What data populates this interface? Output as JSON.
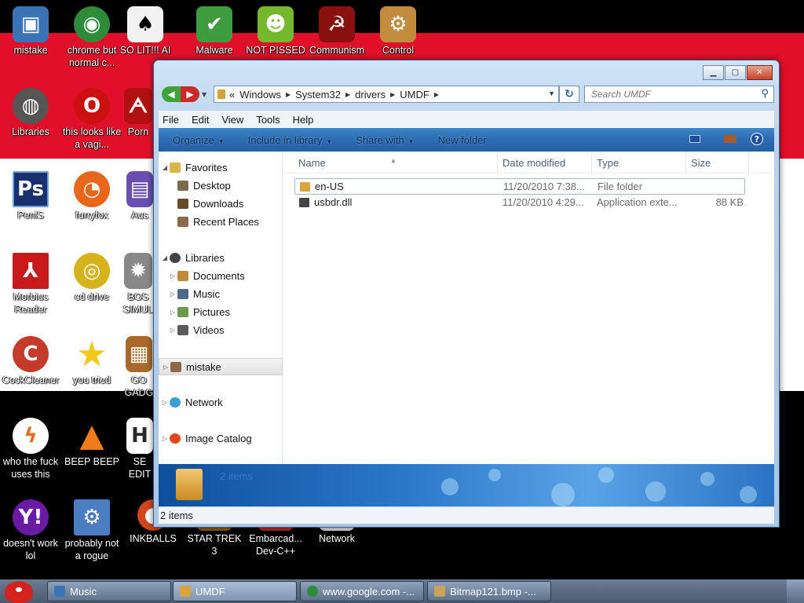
{
  "desktop": {
    "icons": [
      {
        "label": "mistake",
        "icon": "computer-icon",
        "color": "#3a73b6"
      },
      {
        "label": "chrome but normal c...",
        "icon": "chrome-icon",
        "color": "#2e8b3a"
      },
      {
        "label": "SO LIT!!! AI",
        "icon": "cards-icon",
        "color": "#f2f2f2"
      },
      {
        "label": "Malware",
        "icon": "shield-icon",
        "color": "#3e9b3e"
      },
      {
        "label": "NOT PISSED",
        "icon": "pig-icon",
        "color": "#74b82b"
      },
      {
        "label": "Communism",
        "icon": "banner-icon",
        "color": "#8a1010"
      },
      {
        "label": "Control",
        "icon": "control-panel-icon",
        "color": "#c38b3c"
      },
      {
        "label": "Libraries",
        "icon": "library-icon",
        "color": "#555555"
      },
      {
        "label": "this looks like a vagi...",
        "icon": "opera-icon",
        "color": "#cc1010"
      },
      {
        "label": "Porn",
        "icon": "acrobat-icon",
        "color": "#b01010"
      },
      {
        "label": "PeniS",
        "icon": "photoshop-icon",
        "color": "#1a2f6e"
      },
      {
        "label": "furryfox",
        "icon": "firefox-icon",
        "color": "#e8661a"
      },
      {
        "label": "Aus",
        "icon": "app-icon",
        "color": "#6a4fb0"
      },
      {
        "label": "Morbius Reader",
        "icon": "pdf-reader-icon",
        "color": "#c81a1a"
      },
      {
        "label": "cd drive",
        "icon": "cd-icon",
        "color": "#d6b21c"
      },
      {
        "label": "BOS SIMUL",
        "icon": "gear-icon",
        "color": "#888888"
      },
      {
        "label": "CockCleaner",
        "icon": "ccleaner-icon",
        "color": "#c43b2a"
      },
      {
        "label": "you tried",
        "icon": "star-icon",
        "color": "#f2c81a"
      },
      {
        "label": "GO GADG",
        "icon": "box-icon",
        "color": "#a8692a"
      },
      {
        "label": "who the fuck uses this",
        "icon": "lightning-icon",
        "color": "#e36b1a"
      },
      {
        "label": "BEEP BEEP",
        "icon": "vlc-icon",
        "color": "#f07d1a"
      },
      {
        "label": "SE EDIT",
        "icon": "hex-editor-icon",
        "color": "#2a2a2a"
      },
      {
        "label": "doesn't work lol",
        "icon": "yahoo-icon",
        "color": "#6b1aa6"
      },
      {
        "label": "probably not a rogue",
        "icon": "settings-icon",
        "color": "#4a7ec0"
      },
      {
        "label": "INKBALLS",
        "icon": "ball-icon",
        "color": "#d4461a"
      },
      {
        "label": "STAR TREK 3",
        "icon": "game-icon",
        "color": "#8a5a1a"
      },
      {
        "label": "Embarcad... Dev-C++",
        "icon": "devcpp-icon",
        "color": "#b02a2a"
      },
      {
        "label": "Network",
        "icon": "network-icon",
        "color": "#e0e0e0"
      }
    ]
  },
  "window": {
    "address": {
      "overflow": "«",
      "segments": [
        "Windows",
        "System32",
        "drivers",
        "UMDF"
      ]
    },
    "search_placeholder": "Search UMDF",
    "menu": [
      "File",
      "Edit",
      "View",
      "Tools",
      "Help"
    ],
    "commands": [
      {
        "label": "Organize",
        "dropdown": true
      },
      {
        "label": "Include in library",
        "dropdown": true
      },
      {
        "label": "Share with",
        "dropdown": true
      },
      {
        "label": "New folder",
        "dropdown": false
      }
    ],
    "help_glyph": "?",
    "nav": [
      {
        "label": "Favorites",
        "level": 0,
        "expanded": true,
        "icon": "star-icon",
        "color": "#d9b54a"
      },
      {
        "label": "Desktop",
        "level": 1,
        "icon": "desktop-icon",
        "color": "#7c6a4e"
      },
      {
        "label": "Downloads",
        "level": 1,
        "icon": "downloads-icon",
        "color": "#6b4a2a"
      },
      {
        "label": "Recent Places",
        "level": 1,
        "icon": "recent-places-icon",
        "color": "#8a6a4a"
      },
      {
        "label": "Libraries",
        "level": 0,
        "expanded": true,
        "icon": "library-icon",
        "color": "#444444"
      },
      {
        "label": "Documents",
        "level": 1,
        "collapsed": true,
        "icon": "documents-icon",
        "color": "#c08a3a"
      },
      {
        "label": "Music",
        "level": 1,
        "collapsed": true,
        "icon": "music-icon",
        "color": "#4a6a8a"
      },
      {
        "label": "Pictures",
        "level": 1,
        "collapsed": true,
        "icon": "pictures-icon",
        "color": "#6a9a4a"
      },
      {
        "label": "Videos",
        "level": 1,
        "collapsed": true,
        "icon": "videos-icon",
        "color": "#5a5a5a"
      },
      {
        "label": "mistake",
        "level": 0,
        "collapsed": true,
        "selected": true,
        "icon": "homegroup-icon",
        "color": "#8a6a4a"
      },
      {
        "label": "Network",
        "level": 0,
        "collapsed": true,
        "icon": "network-icon",
        "color": "#3aa0d6"
      },
      {
        "label": "Image Catalog",
        "level": 0,
        "collapsed": true,
        "icon": "image-catalog-icon",
        "color": "#e04a1a"
      }
    ],
    "columns": [
      "Name",
      "Date modified",
      "Type",
      "Size"
    ],
    "files": [
      {
        "name": "en-US",
        "date": "11/20/2010 7:38...",
        "type": "File folder",
        "size": "",
        "icon": "folder-icon",
        "color": "#d9a53a"
      },
      {
        "name": "usbdr.dll",
        "date": "11/20/2010 4:29...",
        "type": "Application exte...",
        "size": "88 KB",
        "icon": "dll-icon",
        "color": "#444444"
      }
    ],
    "details_count": "2 items",
    "status_text": "2 items"
  },
  "taskbar": {
    "buttons": [
      {
        "label": "Music",
        "icon": "media-player-icon",
        "color": "#3a73b6",
        "active": false
      },
      {
        "label": "UMDF",
        "icon": "folder-icon",
        "color": "#d9a53a",
        "active": true
      },
      {
        "label": "www.google.com -...",
        "icon": "chrome-icon",
        "color": "#2e8b3a",
        "active": false
      },
      {
        "label": "Bitmap121.bmp -...",
        "icon": "paint-icon",
        "color": "#c9a45a",
        "active": false
      }
    ]
  }
}
